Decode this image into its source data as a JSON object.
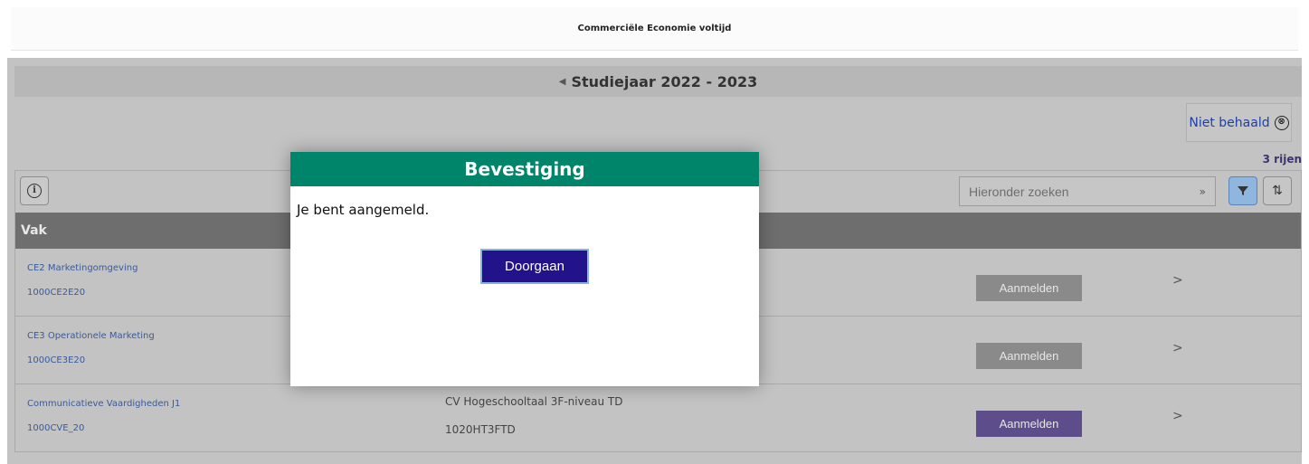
{
  "header": {
    "title": "Commerciële Economie voltijd"
  },
  "study_year": {
    "prev_arrow": "◀",
    "label": "Studiejaar 2022 - 2023"
  },
  "filter_chip": {
    "label": "Niet behaald",
    "close_glyph": "⊗"
  },
  "grid": {
    "row_count": "3 rijen",
    "info_glyph": "i",
    "search": {
      "placeholder": "Hieronder zoeken",
      "go_glyph": "»"
    },
    "sort_glyph": "⇅",
    "column_header": "Vak",
    "rows": [
      {
        "course": "CE2 Marketingomgeving",
        "code": "1000CE2E20",
        "alt_title": "",
        "alt_code": "",
        "button": "Aanmelden",
        "button_state": "disabled",
        "chevron": ">"
      },
      {
        "course": "CE3 Operationele Marketing",
        "code": "1000CE3E20",
        "alt_title": "",
        "alt_code": "",
        "button": "Aanmelden",
        "button_state": "disabled",
        "chevron": ">"
      },
      {
        "course": "Communicatieve Vaardigheden J1",
        "code": "1000CVE_20",
        "alt_title": "CV Hogeschooltaal 3F-niveau TD",
        "alt_code": "1020HT3FTD",
        "button": "Aanmelden",
        "button_state": "active",
        "chevron": ">"
      }
    ]
  },
  "modal": {
    "title": "Bevestiging",
    "message": "Je bent aangemeld.",
    "button": "Doorgaan"
  },
  "colors": {
    "modal_header": "#00846a",
    "primary_button": "#23138a",
    "enroll_active": "#5d4d8b",
    "enroll_disabled": "#8a8a8a",
    "link_text": "#3a5a9a",
    "column_header": "#6e6e6e"
  },
  "icons": [
    "chevron-left-icon",
    "close-circle-icon",
    "info-icon",
    "double-chevron-right-icon",
    "filter-icon",
    "sort-icon",
    "chevron-right-icon"
  ]
}
